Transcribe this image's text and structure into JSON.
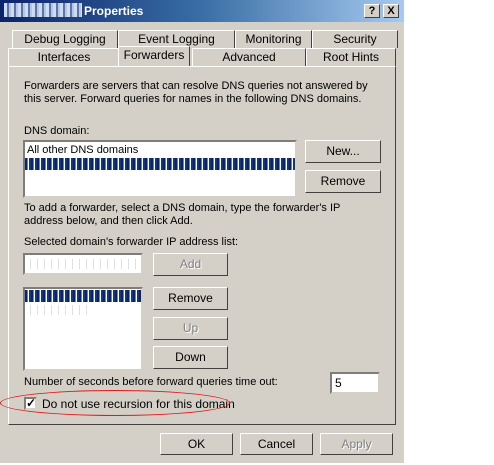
{
  "window": {
    "title": "Properties"
  },
  "titlebar_buttons": {
    "help": "?",
    "close": "X"
  },
  "tabs_row1": [
    "Debug Logging",
    "Event Logging",
    "Monitoring",
    "Security"
  ],
  "tabs_row2": [
    "Interfaces",
    "Forwarders",
    "Advanced",
    "Root Hints"
  ],
  "active_tab": "Forwarders",
  "forwarders": {
    "description": "Forwarders are servers that can resolve DNS queries not answered by this server. Forward queries for names in the following DNS domains.",
    "dns_domain_label": "DNS domain:",
    "dns_domain_items": [
      "All other DNS domains"
    ],
    "new_button": "New...",
    "remove_domain_button": "Remove",
    "instructions": "To add a forwarder, select a DNS domain, type the forwarder's IP address below, and then click Add.",
    "ip_list_label": "Selected domain's forwarder IP address list:",
    "add_button": "Add",
    "remove_ip_button": "Remove",
    "up_button": "Up",
    "down_button": "Down",
    "timeout_label": "Number of seconds before forward queries time out:",
    "timeout_value": "5",
    "recursion_label": "Do not use recursion for this domain",
    "recursion_checked": true
  },
  "footer": {
    "ok": "OK",
    "cancel": "Cancel",
    "apply": "Apply"
  },
  "colors": {
    "face": "#d4d0c8",
    "title_start": "#0a246a",
    "selection": "#0a246a",
    "annotation": "#e01a1a"
  }
}
